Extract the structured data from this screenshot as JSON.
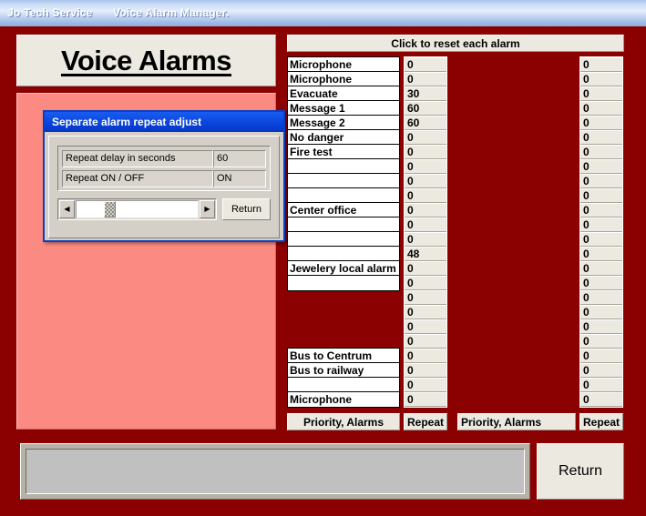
{
  "titlebar": {
    "brand": "Jo Tech Service",
    "title": "Voice Alarm Manager."
  },
  "banner": {
    "title": "Voice Alarms"
  },
  "colors": {
    "window_background": "#8b0000",
    "work_area": "#fa8a82",
    "control_face": "#ece9e0",
    "dialog_titlebar": "#0b47dd",
    "titlebar_text": "#ffffff"
  },
  "dialog": {
    "title": "Separate alarm repeat adjust",
    "rows": [
      {
        "label": "Repeat delay in seconds",
        "value": "60"
      },
      {
        "label": "Repeat ON / OFF",
        "value": "ON"
      }
    ],
    "scrollbar": {
      "left_arrow": "◀",
      "right_arrow": "▶",
      "thumb_position_percent": 25
    },
    "return_label": "Return"
  },
  "grid": {
    "reset_header": "Click to reset each alarm",
    "left": {
      "names_group_1": [
        "Microphone",
        "Microphone",
        "Evacuate",
        "Message 1",
        "Message 2",
        "No danger",
        "Fire test",
        "",
        "",
        "",
        "Center office",
        "",
        "",
        "",
        "Jewelery local alarm",
        ""
      ],
      "names_group_2": [
        "Bus to Centrum",
        "Bus to railway",
        "",
        "Microphone"
      ],
      "values": [
        "0",
        "0",
        "30",
        "60",
        "60",
        "0",
        "0",
        "0",
        "0",
        "0",
        "0",
        "0",
        "0",
        "48",
        "0",
        "0",
        "0",
        "0",
        "0",
        "0",
        "0",
        "0",
        "0",
        "0"
      ],
      "priority_button": "Priority,  Alarms",
      "repeat_button": "Repeat"
    },
    "right": {
      "names": [
        "",
        "",
        "",
        "",
        "",
        "",
        "",
        "",
        "",
        "",
        "",
        "",
        "",
        "",
        "",
        "",
        "",
        "",
        "",
        "",
        "",
        "",
        "",
        ""
      ],
      "values": [
        "0",
        "0",
        "0",
        "0",
        "0",
        "0",
        "0",
        "0",
        "0",
        "0",
        "0",
        "0",
        "0",
        "0",
        "0",
        "0",
        "0",
        "0",
        "0",
        "0",
        "0",
        "0",
        "0",
        "0"
      ],
      "priority_button": "Priority,  Alarms",
      "repeat_button": "Repeat"
    }
  },
  "footer": {
    "status_text": "",
    "return_label": "Return"
  }
}
